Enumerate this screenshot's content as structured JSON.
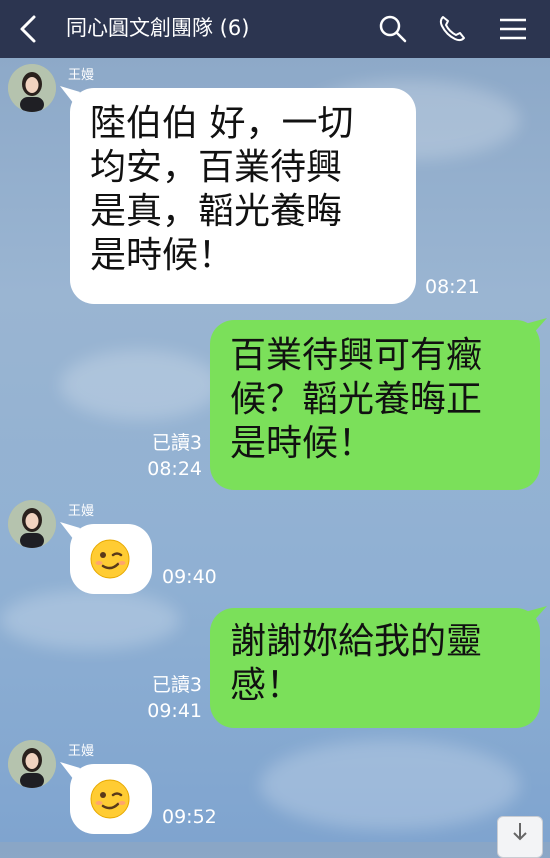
{
  "header": {
    "title": "同心圓文創團隊 (6)",
    "back_icon": "chevron-left-icon",
    "search_icon": "search-icon",
    "call_icon": "phone-icon",
    "menu_icon": "hamburger-menu-icon"
  },
  "colors": {
    "header_bg": "#2c3550",
    "outgoing_bubble": "#7be05a",
    "incoming_bubble": "#ffffff"
  },
  "messages": [
    {
      "sender": "王嫚",
      "text_lines": [
        "陸伯伯 好，一切",
        "均安，百業待興",
        "是真，韜光養晦",
        "是時候！"
      ],
      "time": "08:21"
    },
    {
      "read": "已讀3",
      "time": "08:24",
      "text_lines": [
        "百業待興可有癥",
        "候？韜光養晦正",
        "是時候！"
      ]
    },
    {
      "sender": "王嫚",
      "emoji": "winking-face",
      "time": "09:40"
    },
    {
      "read": "已讀3",
      "time": "09:41",
      "text_lines": [
        "謝謝妳給我的靈",
        "感！"
      ]
    },
    {
      "sender": "王嫚",
      "emoji": "winking-face",
      "time": "09:52"
    }
  ]
}
